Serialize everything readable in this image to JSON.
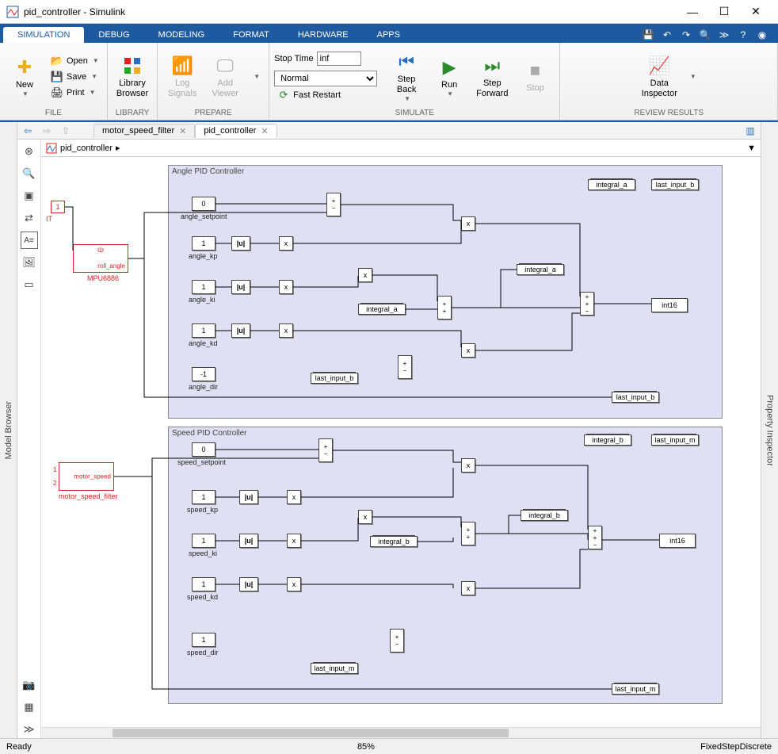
{
  "window": {
    "title": "pid_controller - Simulink",
    "min": "—",
    "max": "☐",
    "close": "✕"
  },
  "ribbon": {
    "tabs": [
      "SIMULATION",
      "DEBUG",
      "MODELING",
      "FORMAT",
      "HARDWARE",
      "APPS"
    ],
    "active_tab": 0
  },
  "toolstrip": {
    "file": {
      "group": "FILE",
      "new": "New",
      "open": "Open",
      "save": "Save",
      "print": "Print"
    },
    "library": {
      "group": "LIBRARY",
      "btn": "Library\nBrowser"
    },
    "prepare": {
      "group": "PREPARE",
      "log": "Log\nSignals",
      "add": "Add\nViewer"
    },
    "simulate": {
      "group": "SIMULATE",
      "stop_time_label": "Stop Time",
      "stop_time_value": "inf",
      "mode": "Normal",
      "fast_restart": "Fast Restart",
      "step_back": "Step\nBack",
      "run": "Run",
      "step_fwd": "Step\nForward",
      "stop": "Stop"
    },
    "review": {
      "group": "REVIEW RESULTS",
      "inspector": "Data\nInspector"
    }
  },
  "side": {
    "left": "Model Browser",
    "right": "Property Inspector"
  },
  "tabs": [
    "motor_speed_filter",
    "pid_controller"
  ],
  "active_tab": 1,
  "breadcrumb": "pid_controller",
  "diagram": {
    "area_angle": "Angle PID Controller",
    "area_speed": "Speed PID Controller",
    "mpu": {
      "port": "1",
      "label": "MPU6886",
      "out": "roll_angle"
    },
    "msf": {
      "p1": "1",
      "p2": "2",
      "label": "motor_speed_filter",
      "out": "motor_speed"
    },
    "angle": {
      "setpoint": {
        "v": "0",
        "l": "angle_setpoint"
      },
      "kp": {
        "v": "1",
        "l": "angle_kp"
      },
      "ki": {
        "v": "1",
        "l": "angle_ki"
      },
      "kd": {
        "v": "1",
        "l": "angle_kd"
      },
      "dir": {
        "v": "-1",
        "l": "angle_dir"
      },
      "abs": "|u|",
      "prod": "x",
      "ds_integral": "integral_a",
      "ds_last": "last_input_b",
      "dsr_integral": "integral_a",
      "dsr_last": "last_input_b",
      "out": "int16"
    },
    "speed": {
      "setpoint": {
        "v": "0",
        "l": "speed_setpoint"
      },
      "kp": {
        "v": "1",
        "l": "speed_kp"
      },
      "ki": {
        "v": "1",
        "l": "speed_ki"
      },
      "kd": {
        "v": "1",
        "l": "speed_kd"
      },
      "dir": {
        "v": "1",
        "l": "speed_dir"
      },
      "abs": "|u|",
      "prod": "x",
      "ds_integral": "integral_b",
      "ds_last": "last_input_m",
      "dsr_integral": "integral_b",
      "dsr_last": "last_input_m",
      "out": "int16"
    }
  },
  "status": {
    "ready": "Ready",
    "zoom": "85%",
    "solver": "FixedStepDiscrete"
  }
}
